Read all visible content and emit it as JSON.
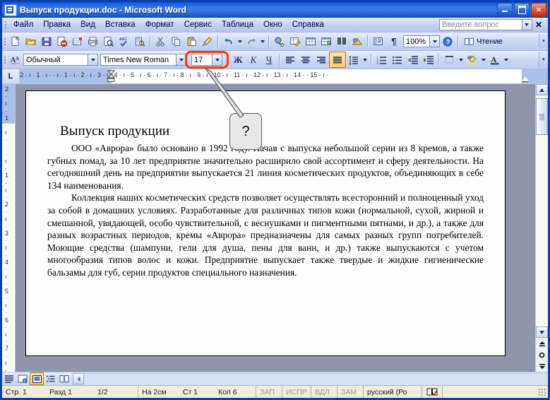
{
  "window": {
    "title": "Выпуск продукции.doc - Microsoft Word",
    "app_icon": "word-document-icon",
    "minimize": "minimize-icon",
    "maximize": "maximize-icon",
    "close": "close-icon"
  },
  "menubar": {
    "items": [
      {
        "label": "Файл"
      },
      {
        "label": "Правка"
      },
      {
        "label": "Вид"
      },
      {
        "label": "Вставка"
      },
      {
        "label": "Формат"
      },
      {
        "label": "Сервис"
      },
      {
        "label": "Таблица"
      },
      {
        "label": "Окно"
      },
      {
        "label": "Справка"
      }
    ],
    "ask_box": {
      "placeholder": "Введите вопрос",
      "value": ""
    },
    "close_label": "✕"
  },
  "standard_toolbar": {
    "buttons": [
      {
        "name": "new-document-icon",
        "glyph": "🗋"
      },
      {
        "name": "open-folder-icon",
        "glyph": "📂"
      },
      {
        "name": "save-icon",
        "glyph": "💾"
      },
      {
        "name": "permission-icon",
        "glyph": "🛇"
      },
      {
        "name": "email-icon",
        "glyph": "✉"
      },
      {
        "name": "print-icon",
        "glyph": "🖨"
      },
      {
        "name": "print-preview-icon",
        "glyph": "🔍"
      },
      {
        "name": "spelling-icon",
        "glyph": "ABC"
      },
      {
        "name": "research-icon",
        "glyph": "📖"
      },
      {
        "name": "cut-icon",
        "glyph": "✂"
      },
      {
        "name": "copy-icon",
        "glyph": "⎘"
      },
      {
        "name": "paste-icon",
        "glyph": "📋"
      },
      {
        "name": "format-painter-icon",
        "glyph": "🖌"
      },
      {
        "name": "undo-icon",
        "glyph": "↶"
      },
      {
        "name": "redo-icon",
        "glyph": "↷"
      },
      {
        "name": "hyperlink-icon",
        "glyph": "🔗"
      },
      {
        "name": "tables-borders-icon",
        "glyph": "▦"
      },
      {
        "name": "insert-table-icon",
        "glyph": "▤"
      },
      {
        "name": "insert-excel-sheet-icon",
        "glyph": "▩"
      },
      {
        "name": "columns-icon",
        "glyph": "▥"
      },
      {
        "name": "drawing-icon",
        "glyph": "◿"
      },
      {
        "name": "document-map-icon",
        "glyph": "🗺"
      },
      {
        "name": "show-formatting-marks-icon",
        "glyph": "¶"
      }
    ],
    "zoom": {
      "value": "100%",
      "label": "zoom-combo"
    },
    "help_icon": "help-icon",
    "reading_button": {
      "label": "Чтение",
      "icon": "book-icon"
    }
  },
  "formatting_toolbar": {
    "styles_icon": "styles-and-formatting-icon",
    "style": {
      "value": "Обычный"
    },
    "font": {
      "value": "Times New Roman"
    },
    "size": {
      "value": "17",
      "highlighted": true,
      "highlight_color": "#f03c12"
    },
    "bold": "Ж",
    "italic": "К",
    "underline": "Ч",
    "align_left": "align-left-icon",
    "align_center": "align-center-icon",
    "align_right": "align-right-icon",
    "justify": {
      "icon": "justify-icon",
      "active": true
    },
    "line_spacing": "line-spacing-icon",
    "numbered_list": "numbered-list-icon",
    "bulleted_list": "bulleted-list-icon",
    "decrease_indent": "decrease-indent-icon",
    "increase_indent": "increase-indent-icon",
    "borders": "borders-icon",
    "highlight": "highlight-color-icon",
    "font_color": "font-color-icon"
  },
  "ruler": {
    "tab_selector": "L",
    "horizontal_ticks": "2 · ı · 1 · ı ·    · ı · 1 · ı · 2 · ı · 3 · ı · 4 · ı · 5 · ı · 6 · ı · 7 · ı · 8 · ı · 9 · ı · 10 · ı · 11 · ı · 12 · ı · 13 · ı · 14 ·   · 15 · ı ·",
    "vertical_ticks": [
      "2",
      "·",
      "ı",
      "·",
      "1",
      "·",
      "ı",
      "·",
      "",
      "·",
      "ı",
      "·",
      "1",
      "·",
      "ı",
      "·",
      "2",
      "·",
      "ı",
      "·",
      "3",
      "·",
      "ı",
      "·",
      "4",
      "·",
      "ı",
      "·",
      "5",
      "·",
      "ı",
      "·",
      "6",
      "·",
      "ı",
      "·",
      "7",
      "·",
      "ı",
      "·"
    ]
  },
  "document": {
    "heading": "Выпуск продукции",
    "paragraphs": [
      "ООО «Аврора» было основано в 1992 году. Начав с выпуска небольшой серии из 8 кремов, а также губных помад, за 10 лет предприятие значительно расширило свой ассортимент и сферу деятельности. На сегодняшний день на предприятии выпускается 21 линия косметических продуктов, объединяющих в себе 134 наименования.",
      "Коллекция наших косметических средств позволяет осуществлять всесторонний и полноценный уход за собой в домашних условиях. Разработанные для различных типов кожи (нормальной, сухой, жирной и смешанной, увядающей, особо чувствительной, с веснушками и пигментными пятнами, и др.), а также для разных возрастных периодов, кремы «Аврора» предназначены для самых разных групп потребителей. Моющие средства (шампуни, гели для душа, пены для ванн, и др.) также выпускаются с учетом многообразия типов волос и кожи. Предприятие выпускает также твердые и жидкие гигиенические бальзамы для губ, серии продуктов специального назначения."
    ]
  },
  "callout": {
    "text": "?",
    "points_to": "font-size-box"
  },
  "scrollbars": {
    "vertical": {
      "up": "scroll-up-icon",
      "down": "scroll-down-icon",
      "prev_page": "previous-page-icon",
      "select_browse_object": "select-browse-object-icon",
      "next_page": "next-page-icon"
    },
    "horizontal": {
      "left": "scroll-left-icon",
      "right": "scroll-right-icon"
    }
  },
  "view_bar": {
    "buttons": [
      {
        "name": "normal-view-button",
        "glyph": "≡",
        "active": false
      },
      {
        "name": "web-layout-view-button",
        "glyph": "🖻",
        "active": false
      },
      {
        "name": "print-layout-view-button",
        "glyph": "▤",
        "active": true
      },
      {
        "name": "outline-view-button",
        "glyph": "⋮≡",
        "active": false
      },
      {
        "name": "reading-layout-view-button",
        "glyph": "📖",
        "active": false
      }
    ]
  },
  "status_bar": {
    "page": "Стр. 1",
    "section": "Разд 1",
    "page_of": "1/2",
    "at": "На 2см",
    "line": "Ст 1",
    "column": "Кол 6",
    "rec": "ЗАП",
    "trk": "ИСПР",
    "ext": "ВДЛ",
    "ovr": "ЗАМ",
    "language": "русский (Ро",
    "spellcheck_icon": "spellcheck-book-icon"
  }
}
